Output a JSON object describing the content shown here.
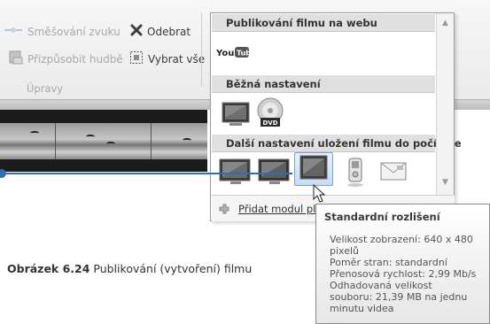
{
  "ribbon": {
    "mix_audio_label": "Směšování zvuku",
    "remove_label": "Odebrat",
    "fit_to_music_label": "Přizpůsobit hudbě",
    "select_all_label": "Vybrat vše",
    "group_label": "Úpravy"
  },
  "gallery": {
    "section_publish": "Publikování filmu na webu",
    "youtube_label": "You Tube",
    "section_common": "Běžná nastavení",
    "dvd_label": "DVD",
    "section_more": "Další nastavení uložení filmu do počítače",
    "footer_add_plugin": "Přidat modul plug-in",
    "scroll_up_icon": "triangle-up-icon",
    "scroll_down_icon": "triangle-down-icon"
  },
  "tooltip": {
    "title": "Standardní rozlišení",
    "body": "Velikost zobrazení: 640 x 480\npixelů\nPoměr stran: standardní\nPřenosová rychlost: 2,99 Mb/s\nOdhadovaná velikost\nsouboru: 21,39 MB na jednu\nminutu videa"
  },
  "caption": {
    "label": "Obrázek 6.24",
    "text": " Publikování (vytvoření) filmu"
  },
  "colors": {
    "accent": "#2b6fb6",
    "selection_bg": "#c6dbf3",
    "section_header_bg": "#e0e0e0"
  }
}
